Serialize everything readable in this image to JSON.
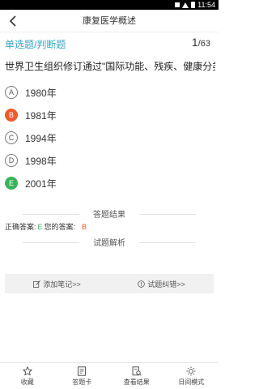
{
  "status_bar": {
    "time": "11:54"
  },
  "header": {
    "title": "康复医学概述"
  },
  "question": {
    "type": "单选题/判断题",
    "current": "1",
    "total": "/63",
    "text": "世界卫生组织修订通过\"国际功能、残疾、健康分类\"是"
  },
  "options": [
    {
      "letter": "A",
      "text": "1980年",
      "state": "normal"
    },
    {
      "letter": "B",
      "text": "1981年",
      "state": "wrong"
    },
    {
      "letter": "C",
      "text": "1994年",
      "state": "normal"
    },
    {
      "letter": "D",
      "text": "1998年",
      "state": "normal"
    },
    {
      "letter": "E",
      "text": "2001年",
      "state": "right"
    }
  ],
  "result": {
    "section_title": "答题结果",
    "correct_label": "正确答案:",
    "correct_value": "E",
    "mine_label": "您的答案:",
    "mine_value": "B"
  },
  "analysis": {
    "section_title": "试题解析"
  },
  "actions": {
    "note": "添加笔记>>",
    "report": "试题纠错>>"
  },
  "tabbar": [
    {
      "label": "收藏",
      "icon": "star-icon"
    },
    {
      "label": "答题卡",
      "icon": "card-icon"
    },
    {
      "label": "查看结果",
      "icon": "result-icon"
    },
    {
      "label": "日间模式",
      "icon": "sun-icon"
    }
  ],
  "colors": {
    "accent": "#3aa6c2",
    "wrong": "#ef5a2a",
    "right": "#3ab25a"
  }
}
